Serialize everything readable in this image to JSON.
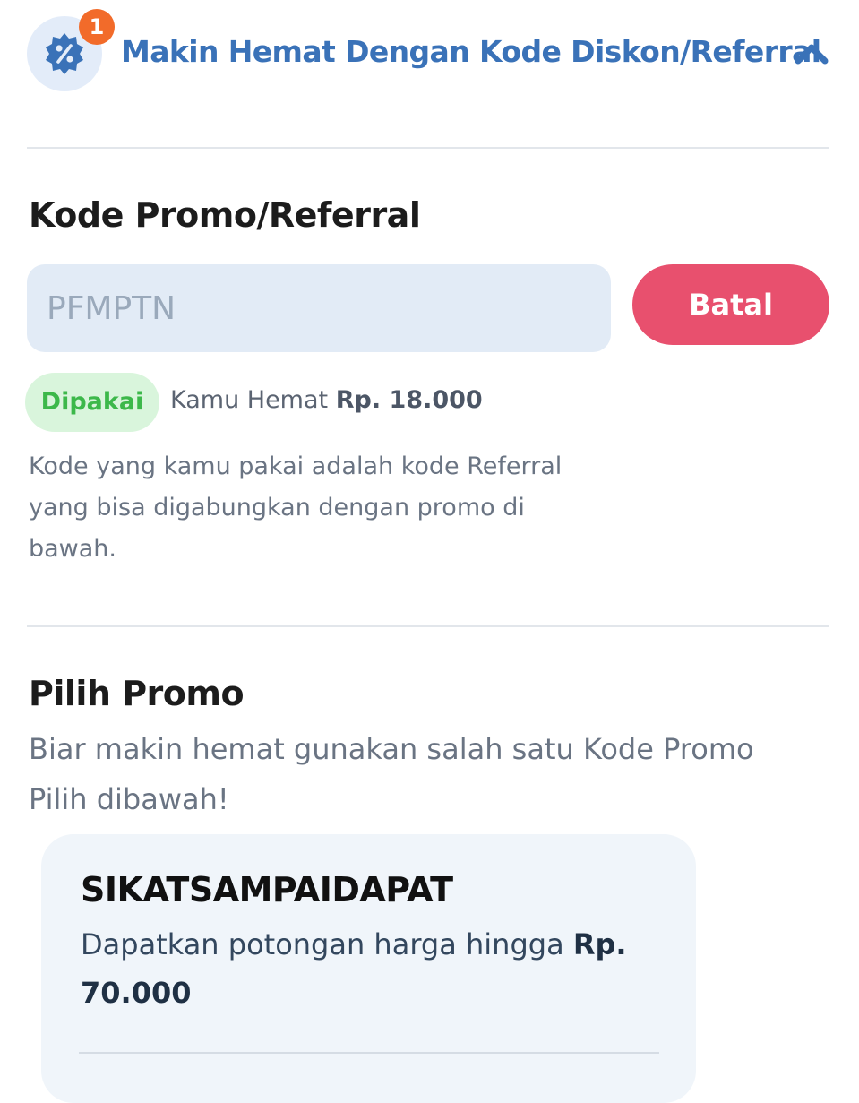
{
  "header": {
    "badge_count": "1",
    "title": "Makin Hemat Dengan Kode Diskon/Referral",
    "accent_color": "#3a72b8",
    "icon": "discount-gear-icon",
    "toggle_icon": "chevron-up-icon"
  },
  "referral": {
    "title": "Kode Promo/Referral",
    "input_value": "PFMPTN",
    "cancel_label": "Batal",
    "status_label": "Dipakai",
    "savings_prefix": "Kamu Hemat",
    "savings_amount": "Rp. 18.000",
    "note": "Kode yang kamu pakai adalah kode Referral yang bisa digabungkan dengan promo di bawah."
  },
  "promo": {
    "title": "Pilih Promo",
    "description": "Biar makin hemat gunakan salah satu Kode Promo Pilih dibawah!",
    "cards": [
      {
        "code": "SIKATSAMPAIDAPAT",
        "text_prefix": "Dapatkan potongan harga hingga",
        "amount": "Rp. 70.000"
      }
    ]
  },
  "colors": {
    "cancel": "#e8506e",
    "badge": "#f26b2a",
    "status_bg": "#d9f5dc",
    "status_text": "#3cb84a"
  }
}
